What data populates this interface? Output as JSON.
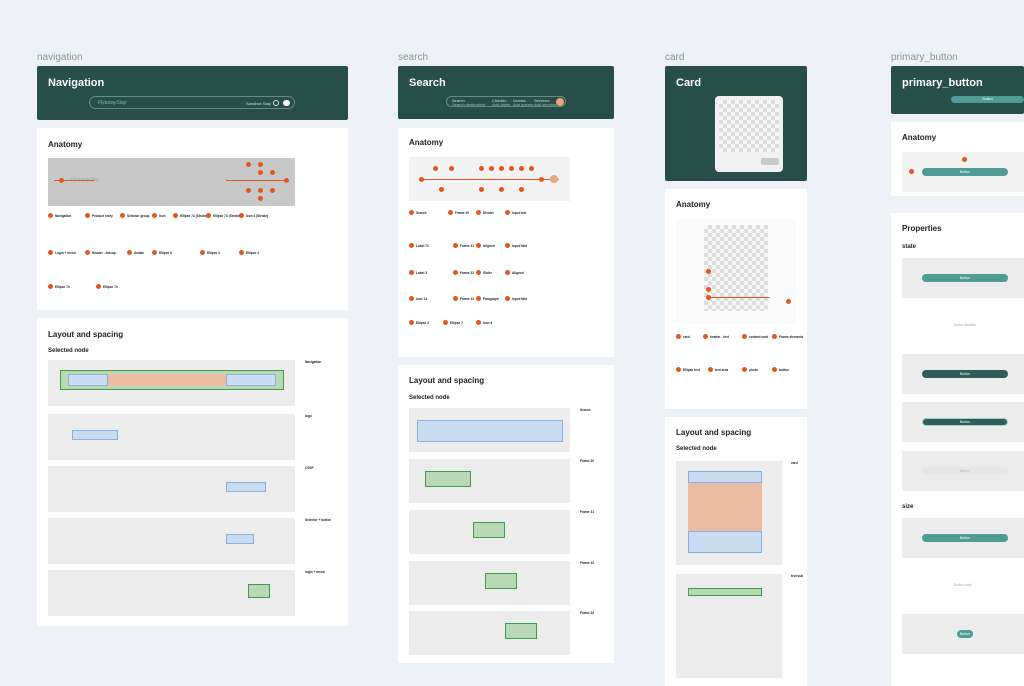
{
  "frames": [
    {
      "id": "navigation",
      "label": "navigation",
      "title": "Navigation"
    },
    {
      "id": "search",
      "label": "search",
      "title": "Search"
    },
    {
      "id": "card",
      "label": "card",
      "title": "Card"
    },
    {
      "id": "primary_button",
      "label": "primary_button",
      "title": "primary_button"
    }
  ],
  "sections": {
    "anatomy": "Anatomy",
    "layout": "Layout and spacing",
    "selected_node": "Selected node",
    "properties": "Properties",
    "state": "state",
    "size": "size"
  },
  "navigation": {
    "logo": "FlyawayStay",
    "nav_link": "Sandbox Stay",
    "anatomy_items": [
      "Navigation",
      "Product entry",
      "Selector group",
      "Icon",
      "Ellipse 74 (Stroke)",
      "Ellipse 74 (Stroke)",
      "Icon 4 (Stroke)",
      "Login + menu",
      "Header - Inkcap",
      "Avatar",
      "Ellipse 8",
      "Ellipse 4",
      "Ellipse 4",
      "Ellipse 74"
    ],
    "layout_items": [
      "Navigation",
      "logo",
      "CSSP",
      "Selector + button",
      "login + menu"
    ]
  },
  "search": {
    "fields": [
      {
        "label": "Search",
        "value": "Search destination"
      },
      {
        "label": "Checkin",
        "value": "Add dates"
      },
      {
        "label": "Guests",
        "value": "Add guests"
      },
      {
        "label": "Services",
        "value": "Add services"
      }
    ],
    "anatomy_items": [
      "Search",
      "Frame 30",
      "Divider",
      "Input text",
      "Label 71",
      "Frame 31",
      "Aligned",
      "Input field",
      "Label 3",
      "Frame 32",
      "Slider",
      "Aligned",
      "Icon 14",
      "Frame 33",
      "Paragraph",
      "Input field",
      "Ellipse 2",
      "Ellipse 7",
      "Icon 4"
    ],
    "layout_items": [
      "Search",
      "Frame 30",
      "Frame 31",
      "Frame 32",
      "Frame 33"
    ]
  },
  "card": {
    "anatomy_items": [
      "card",
      "header - text",
      "content card",
      "Frame elements",
      "Ellipse text",
      "text area",
      "photo",
      "button"
    ],
    "layout_items": [
      "card",
      "text sub"
    ]
  },
  "primary_button": {
    "label": "Button",
    "muted_label": "Button disabled",
    "muted_label_2": "Button small"
  },
  "colors": {
    "hero": "#274e49",
    "accent": "#e2581c",
    "button_teal": "#4e9c95",
    "button_dark": "#2f5e58"
  }
}
